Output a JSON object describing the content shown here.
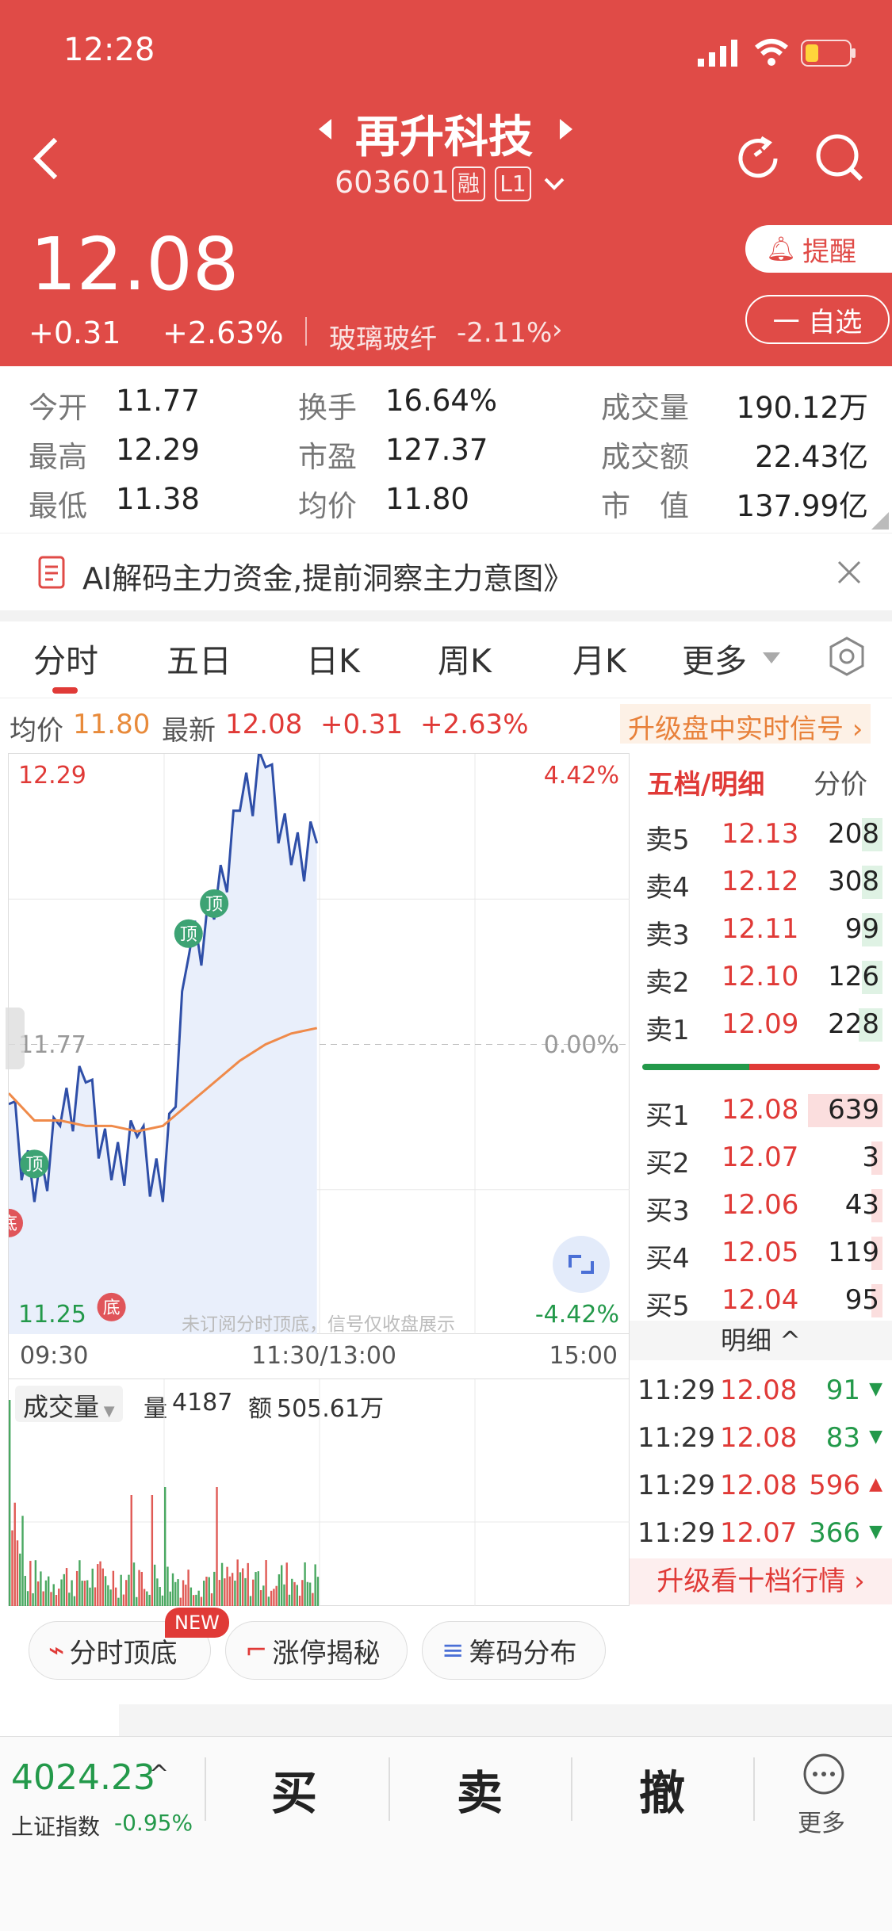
{
  "status": {
    "time": "12:28"
  },
  "stock": {
    "name": "再升科技",
    "code": "603601",
    "badge1": "融",
    "badge2": "L1",
    "price": "12.08",
    "change": "+0.31",
    "pct": "+2.63%",
    "sector": "玻璃玻纤",
    "sector_pct": "-2.11%",
    "remind": "提醒",
    "watch": "一 自选"
  },
  "stats": {
    "open_l": "今开",
    "open_v": "11.77",
    "high_l": "最高",
    "high_v": "12.29",
    "low_l": "最低",
    "low_v": "11.38",
    "turn_l": "换手",
    "turn_v": "16.64%",
    "pe_l": "市盈",
    "pe_v": "127.37",
    "avg_l": "均价",
    "avg_v": "11.80",
    "vol_l": "成交量",
    "vol_v": "190.12万",
    "amt_l": "成交额",
    "amt_v": "22.43亿",
    "cap_l": "市　值",
    "cap_v": "137.99亿"
  },
  "ad": {
    "text": "AI解码主力资金,提前洞察主力意图》"
  },
  "tabs": [
    "分时",
    "五日",
    "日K",
    "周K",
    "月K",
    "更多"
  ],
  "info": {
    "avg_l": "均价",
    "avg_v": "11.80",
    "last_l": "最新",
    "last_v": "12.08",
    "chg": "+0.31",
    "pct": "+2.63%",
    "upgrade": "升级盘中实时信号 ›"
  },
  "chart": {
    "top_price": "12.29",
    "top_pct": "4.42%",
    "mid_price": "11.77",
    "mid_pct": "0.00%",
    "bot_price": "11.25",
    "bot_pct": "-4.42%",
    "note": "未订阅分时顶底，信号仅收盘展示",
    "t1": "09:30",
    "t2": "11:30/13:00",
    "t3": "15:00",
    "marker_top": "顶",
    "marker_bottom": "底"
  },
  "chart_data": {
    "type": "line",
    "x": [
      "09:30",
      "09:40",
      "09:50",
      "10:00",
      "10:10",
      "10:20",
      "10:30",
      "10:40",
      "10:50",
      "11:00",
      "11:10",
      "11:20",
      "11:29"
    ],
    "series": [
      {
        "values": [
          11.66,
          11.48,
          11.62,
          11.7,
          11.52,
          11.6,
          11.48,
          11.93,
          12.0,
          12.2,
          12.28,
          12.1,
          12.14
        ]
      },
      {
        "values": [
          11.68,
          11.63,
          11.63,
          11.62,
          11.62,
          11.61,
          11.62,
          11.66,
          11.7,
          11.74,
          11.77,
          11.79,
          11.8
        ]
      }
    ],
    "ylim": [
      11.25,
      12.29
    ]
  },
  "volume": {
    "label": "成交量",
    "q_l": "量",
    "q_v": "4187",
    "a_l": "额",
    "a_v": "505.61万"
  },
  "book": {
    "title": "五档/明细",
    "tab2": "分价",
    "asks": [
      {
        "l": "卖5",
        "p": "12.13",
        "q": "208"
      },
      {
        "l": "卖4",
        "p": "12.12",
        "q": "308"
      },
      {
        "l": "卖3",
        "p": "12.11",
        "q": "99"
      },
      {
        "l": "卖2",
        "p": "12.10",
        "q": "126"
      },
      {
        "l": "卖1",
        "p": "12.09",
        "q": "228"
      }
    ],
    "bids": [
      {
        "l": "买1",
        "p": "12.08",
        "q": "639"
      },
      {
        "l": "买2",
        "p": "12.07",
        "q": "3"
      },
      {
        "l": "买3",
        "p": "12.06",
        "q": "43"
      },
      {
        "l": "买4",
        "p": "12.05",
        "q": "119"
      },
      {
        "l": "买5",
        "p": "12.04",
        "q": "95"
      }
    ],
    "detail": "明细 ^",
    "trades": [
      {
        "t": "11:29",
        "p": "12.08",
        "q": "91"
      },
      {
        "t": "11:29",
        "p": "12.08",
        "q": "83"
      },
      {
        "t": "11:29",
        "p": "12.08",
        "q": "596"
      },
      {
        "t": "11:29",
        "p": "12.07",
        "q": "366"
      }
    ],
    "upgrade": "升级看十档行情 ›"
  },
  "pills": [
    {
      "label": "分时顶底",
      "badge": "NEW"
    },
    {
      "label": "涨停揭秘"
    },
    {
      "label": "筹码分布"
    }
  ],
  "bottom": {
    "index_val": "4024.23",
    "index_name": "上证指数",
    "index_pct": "-0.95%",
    "buy": "买",
    "sell": "卖",
    "cancel": "撤",
    "more": "更多"
  }
}
